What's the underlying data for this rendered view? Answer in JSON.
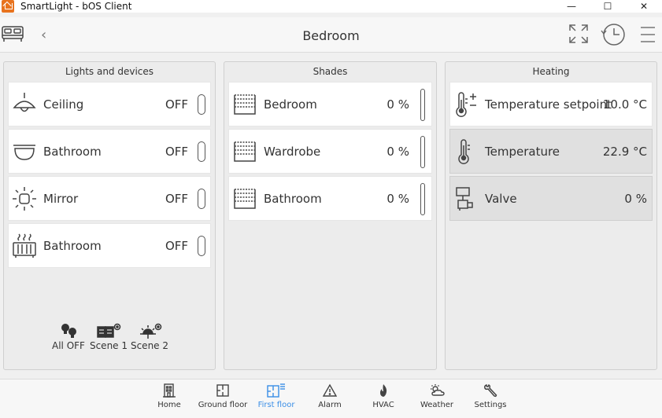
{
  "window": {
    "title": "SmartLight - bOS Client",
    "minimize": "—",
    "maximize": "☐",
    "close": "✕"
  },
  "header": {
    "title": "Bedroom",
    "back": "‹"
  },
  "panels": {
    "lights": {
      "title": "Lights and devices",
      "rows": [
        {
          "label": "Ceiling",
          "value": "OFF",
          "icon": "ceiling-lamp-icon"
        },
        {
          "label": "Bathroom",
          "value": "OFF",
          "icon": "wall-lamp-icon"
        },
        {
          "label": "Mirror",
          "value": "OFF",
          "icon": "bulb-icon"
        },
        {
          "label": "Bathroom",
          "value": "OFF",
          "icon": "heater-icon"
        }
      ],
      "scenes": [
        {
          "label": "All OFF",
          "icon": "bulbs-off-icon"
        },
        {
          "label": "Scene 1",
          "icon": "scene-book-icon"
        },
        {
          "label": "Scene 2",
          "icon": "scene-sunset-icon"
        }
      ]
    },
    "shades": {
      "title": "Shades",
      "rows": [
        {
          "label": "Bedroom",
          "value": "0 %"
        },
        {
          "label": "Wardrobe",
          "value": "0 %"
        },
        {
          "label": "Bathroom",
          "value": "0 %"
        }
      ]
    },
    "heating": {
      "title": "Heating",
      "rows": [
        {
          "label": "Temperature setpoint",
          "value": "10.0 °C",
          "icon": "thermometer-setpoint-icon"
        },
        {
          "label": "Temperature",
          "value": "22.9 °C",
          "icon": "thermometer-icon"
        },
        {
          "label": "Valve",
          "value": "0 %",
          "icon": "valve-icon"
        }
      ]
    }
  },
  "nav": [
    {
      "label": "Home",
      "icon": "building-icon"
    },
    {
      "label": "Ground floor",
      "icon": "floor-plan-icon"
    },
    {
      "label": "First floor",
      "icon": "floor-plan-active-icon"
    },
    {
      "label": "Alarm",
      "icon": "alarm-icon"
    },
    {
      "label": "HVAC",
      "icon": "flame-icon"
    },
    {
      "label": "Weather",
      "icon": "weather-icon"
    },
    {
      "label": "Settings",
      "icon": "wrench-icon"
    }
  ],
  "colors": {
    "accent": "#3a8ee6",
    "panel": "#ececec",
    "row": "#ffffff",
    "row_selected": "#e0e0e0"
  }
}
